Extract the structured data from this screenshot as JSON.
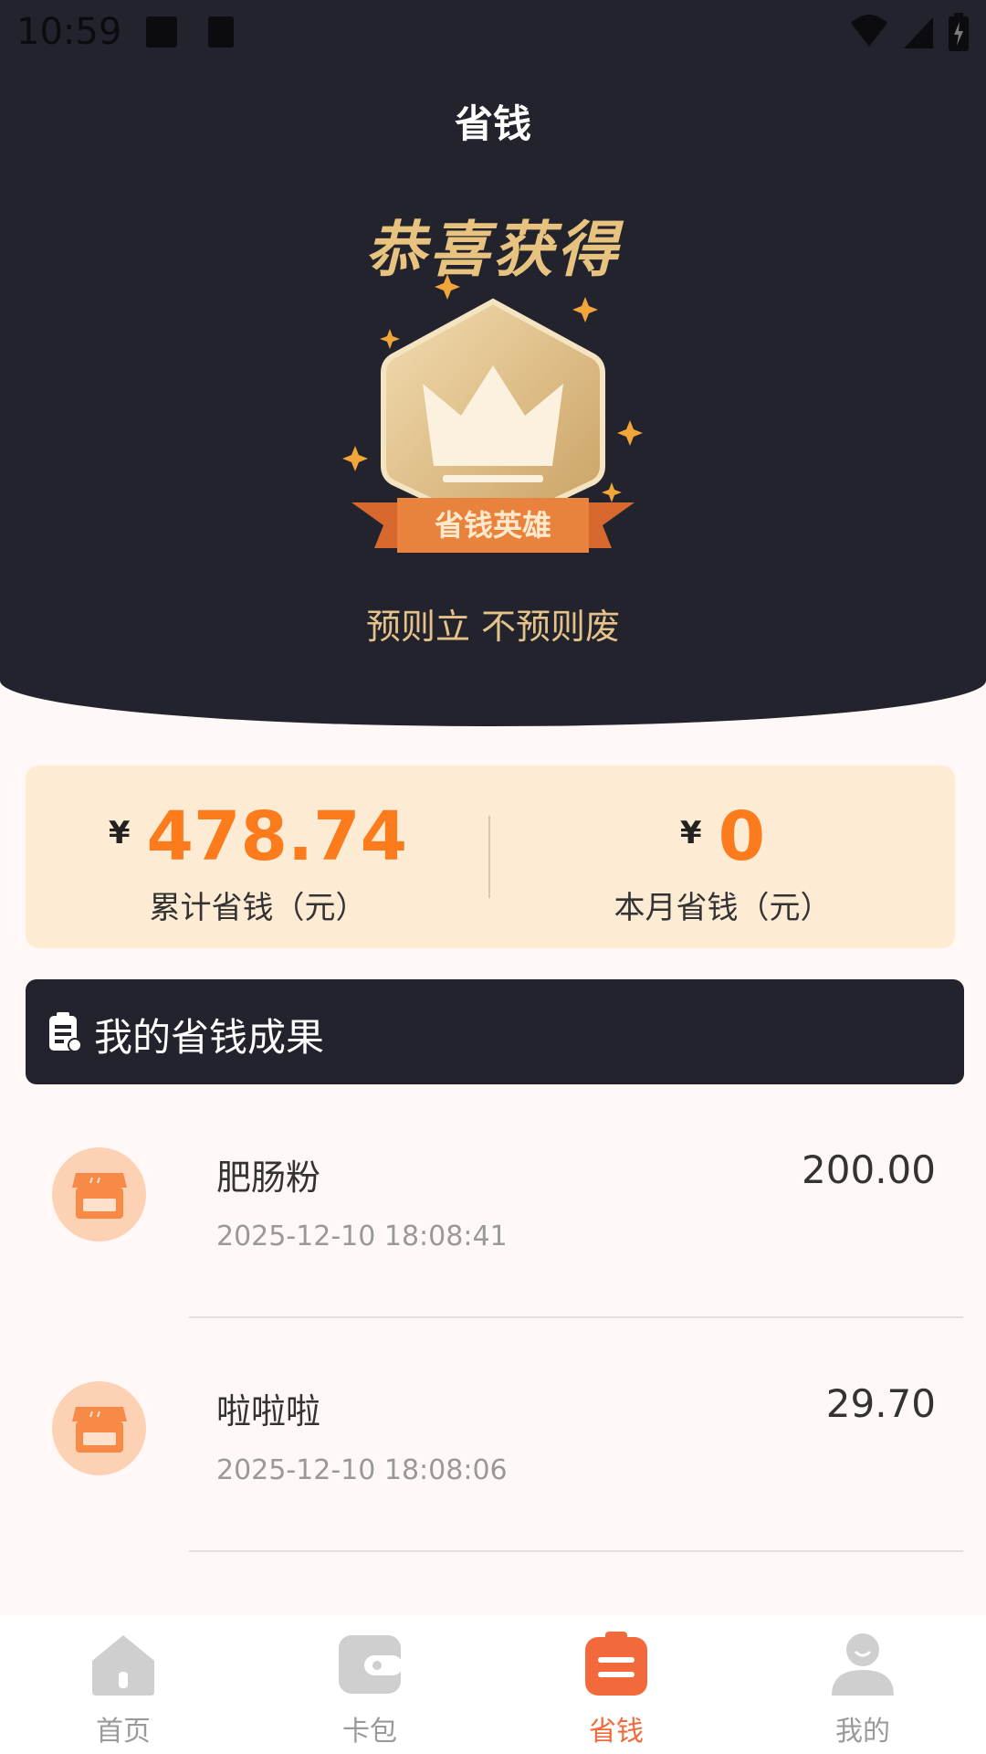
{
  "status_bar": {
    "time": "10:59"
  },
  "header": {
    "title": "省钱"
  },
  "hero": {
    "congrats": "恭喜获得",
    "badge_text": "省钱英雄",
    "slogan": "预则立 不预则废"
  },
  "stats": {
    "currency": "¥",
    "total": {
      "value": "478.74",
      "label": "累计省钱（元）"
    },
    "month": {
      "value": "0",
      "label": "本月省钱（元）"
    }
  },
  "results": {
    "title": "我的省钱成果",
    "items": [
      {
        "name": "肥肠粉",
        "time": "2025-12-10 18:08:41",
        "amount": "200.00"
      },
      {
        "name": "啦啦啦",
        "time": "2025-12-10 18:08:06",
        "amount": "29.70"
      }
    ]
  },
  "bottom_nav": {
    "items": [
      {
        "label": "首页",
        "icon": "home-icon"
      },
      {
        "label": "卡包",
        "icon": "wallet-icon"
      },
      {
        "label": "省钱",
        "icon": "clipboard-icon",
        "active": true
      },
      {
        "label": "我的",
        "icon": "user-icon"
      }
    ]
  },
  "colors": {
    "dark_bg": "#22232c",
    "accent_orange": "#fb7b1d",
    "gold": "#e8c380",
    "card_bg": "#fdecd3",
    "active_nav": "#f26a3b"
  }
}
